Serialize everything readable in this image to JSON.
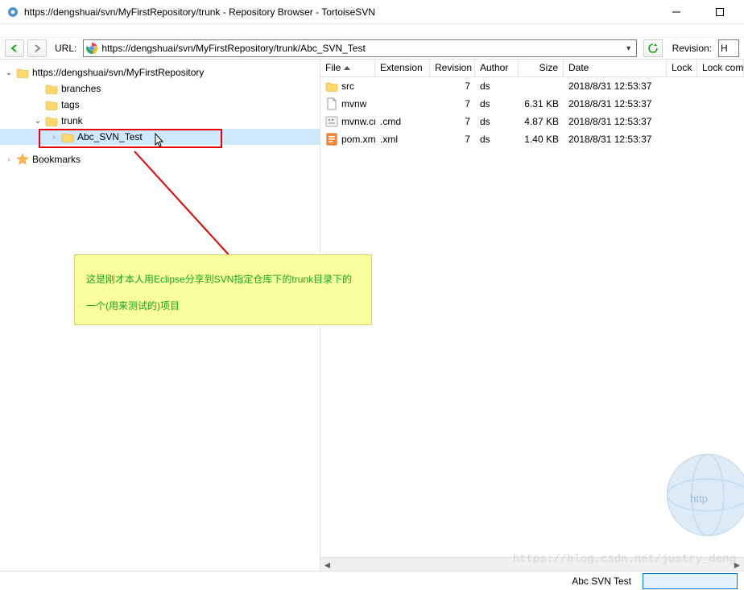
{
  "window": {
    "title": "https://dengshuai/svn/MyFirstRepository/trunk - Repository Browser - TortoiseSVN"
  },
  "toolbar": {
    "url_label": "URL:",
    "url_value": "https://dengshuai/svn/MyFirstRepository/trunk/Abc_SVN_Test",
    "revision_label": "Revision:",
    "revision_value": "H"
  },
  "tree": {
    "root": "https://dengshuai/svn/MyFirstRepository",
    "branches": "branches",
    "tags": "tags",
    "trunk": "trunk",
    "selected": "Abc_SVN_Test",
    "bookmarks": "Bookmarks"
  },
  "columns": {
    "file": "File",
    "ext": "Extension",
    "rev": "Revision",
    "author": "Author",
    "size": "Size",
    "date": "Date",
    "lock": "Lock",
    "lockc": "Lock comment"
  },
  "files": [
    {
      "name": "src",
      "icon": "folder",
      "ext": "",
      "rev": "7",
      "author": "ds",
      "size": "",
      "date": "2018/8/31 12:53:37"
    },
    {
      "name": "mvnw",
      "icon": "file",
      "ext": "",
      "rev": "7",
      "author": "ds",
      "size": "6.31 KB",
      "date": "2018/8/31 12:53:37"
    },
    {
      "name": "mvnw.cmd",
      "icon": "cmd",
      "ext": ".cmd",
      "rev": "7",
      "author": "ds",
      "size": "4.87 KB",
      "date": "2018/8/31 12:53:37"
    },
    {
      "name": "pom.xml",
      "icon": "xml",
      "ext": ".xml",
      "rev": "7",
      "author": "ds",
      "size": "1.40 KB",
      "date": "2018/8/31 12:53:37"
    }
  ],
  "annotation": {
    "text": "这是刚才本人用Eclipse分享到SVN指定仓库下的trunk目录下的一个(用来测试的)项目"
  },
  "status": {
    "text": "Abc SVN Test"
  },
  "watermark": "https://blog.csdn.net/justry_deng"
}
